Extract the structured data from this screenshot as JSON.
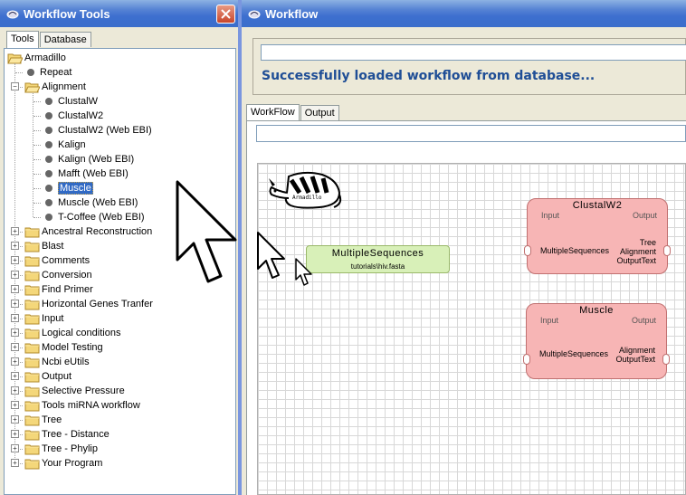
{
  "left_window": {
    "title": "Workflow Tools",
    "tabs": [
      "Tools",
      "Database"
    ],
    "tree": {
      "root": "Armadillo",
      "items": [
        {
          "label": "Repeat",
          "kind": "leaf",
          "level": 1
        },
        {
          "label": "Alignment",
          "kind": "folder-open",
          "level": 1
        },
        {
          "label": "ClustalW",
          "kind": "leaf",
          "level": 2
        },
        {
          "label": "ClustalW2",
          "kind": "leaf",
          "level": 2
        },
        {
          "label": "ClustalW2 (Web EBI)",
          "kind": "leaf",
          "level": 2
        },
        {
          "label": "Kalign",
          "kind": "leaf",
          "level": 2
        },
        {
          "label": "Kalign (Web EBI)",
          "kind": "leaf",
          "level": 2
        },
        {
          "label": "Mafft (Web EBI)",
          "kind": "leaf",
          "level": 2
        },
        {
          "label": "Muscle",
          "kind": "leaf",
          "level": 2,
          "selected": true
        },
        {
          "label": "Muscle (Web EBI)",
          "kind": "leaf",
          "level": 2
        },
        {
          "label": "T-Coffee (Web EBI)",
          "kind": "leaf",
          "level": 2
        },
        {
          "label": "Ancestral Reconstruction",
          "kind": "folder",
          "level": 1
        },
        {
          "label": "Blast",
          "kind": "folder",
          "level": 1
        },
        {
          "label": "Comments",
          "kind": "folder",
          "level": 1
        },
        {
          "label": "Conversion",
          "kind": "folder",
          "level": 1
        },
        {
          "label": "Find Primer",
          "kind": "folder",
          "level": 1
        },
        {
          "label": "Horizontal Genes Tranfer",
          "kind": "folder",
          "level": 1
        },
        {
          "label": "Input",
          "kind": "folder",
          "level": 1
        },
        {
          "label": "Logical conditions",
          "kind": "folder",
          "level": 1
        },
        {
          "label": "Model Testing",
          "kind": "folder",
          "level": 1
        },
        {
          "label": "Ncbi eUtils",
          "kind": "folder",
          "level": 1
        },
        {
          "label": "Output",
          "kind": "folder",
          "level": 1
        },
        {
          "label": "Selective Pressure",
          "kind": "folder",
          "level": 1
        },
        {
          "label": "Tools miRNA workflow",
          "kind": "folder",
          "level": 1
        },
        {
          "label": "Tree",
          "kind": "folder",
          "level": 1
        },
        {
          "label": "Tree - Distance",
          "kind": "folder",
          "level": 1
        },
        {
          "label": "Tree - Phylip",
          "kind": "folder",
          "level": 1
        },
        {
          "label": "Your Program",
          "kind": "folder",
          "level": 1
        }
      ]
    }
  },
  "right_window": {
    "title": "Workflow",
    "status_message": "Successfully loaded workflow from database...",
    "tabs": [
      "WorkFlow",
      "Output"
    ],
    "logo_text": "Armadillo",
    "nodes": {
      "multiple_sequences": {
        "title": "MultipleSequences",
        "subtitle": "tutorials\\hiv.fasta"
      },
      "clustalw2": {
        "title": "ClustalW2",
        "input_label": "Input",
        "output_label": "Output",
        "input_port": "MultipleSequences",
        "outputs": [
          "Tree",
          "Alignment",
          "OutputText"
        ]
      },
      "muscle": {
        "title": "Muscle",
        "input_label": "Input",
        "output_label": "Output",
        "input_port": "MultipleSequences",
        "outputs": [
          "Alignment",
          "OutputText"
        ]
      }
    }
  },
  "colors": {
    "titlebar": "#3d6fcf",
    "status_text": "#1f4e96",
    "node_red": "#f7b5b5",
    "node_green": "#d8f0b8",
    "selection": "#316ac5"
  }
}
